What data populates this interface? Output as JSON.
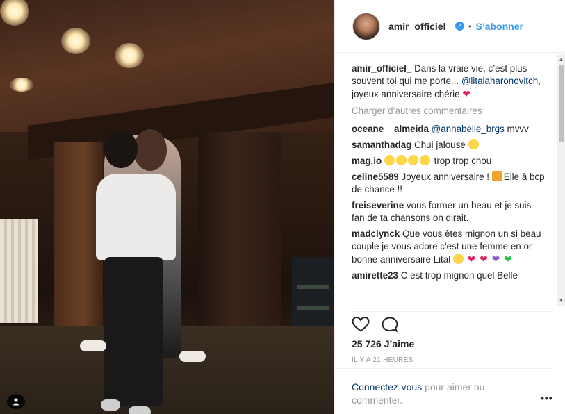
{
  "post": {
    "username": "amir_officiel_",
    "follow_label": "S’abonner",
    "separator": "•",
    "caption_username": "amir_officiel_",
    "caption_text": "Dans la vraie vie, c’est plus souvent toi qui me porte...",
    "caption_mention": "@litalaharonovitch",
    "caption_text_2": ", joyeux anniversaire chérie",
    "load_more": "Charger d’autres commentaires",
    "comments": [
      {
        "user": "oceane__almeida",
        "mention": "@annabelle_brgs",
        "text": " mvvv"
      },
      {
        "user": "samanthadag",
        "text": "Chui jalouse"
      },
      {
        "user": "mag.io",
        "text": " trop trop chou"
      },
      {
        "user": "celine5589",
        "text": "Joyeux anniversaire ! ",
        "text_2": "Elle à bcp de chance !!"
      },
      {
        "user": "freiseverine",
        "text": "vous former un beau et je suis fan de ta chansons on dirait."
      },
      {
        "user": "madclynck",
        "text": "Que vous êtes mignon un si beau couple je vous adore c'est une femme en or bonne anniversaire Lital"
      },
      {
        "user": "amirette23",
        "text": "C est trop mignon quel Belle"
      }
    ],
    "likes": "25 726 J’aime",
    "timestamp": "IL Y A 21 HEURES",
    "login_link": "Connectez-vous",
    "login_text": " pour aimer ou commenter.",
    "more_label": "•••"
  },
  "icons": {
    "verified": "verified-badge-icon",
    "like": "heart-outline-icon",
    "comment": "comment-bubble-icon",
    "user_tag": "user-tag-icon"
  },
  "colors": {
    "accent": "#3897f0",
    "link": "#003569",
    "muted": "#999999",
    "heart": "#e0245e"
  }
}
